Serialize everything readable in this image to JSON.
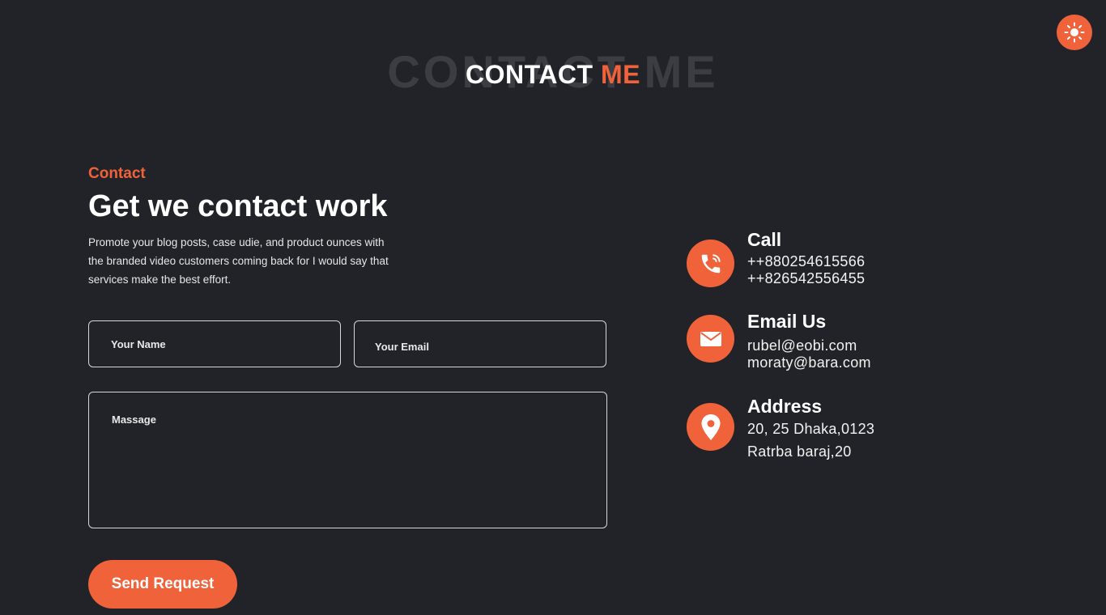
{
  "theme_toggle": {
    "icon": "sun-icon"
  },
  "section_title": {
    "outline_text_main": "CONTACT",
    "outline_text_accent": "ME",
    "main_text": "CONTACT",
    "accent_text": "ME"
  },
  "contact": {
    "eyebrow": "Contact",
    "headline": "Get we contact work",
    "intro_lines": [
      "Promote your blog posts, case udie, and product ounces with",
      "the branded video customers coming back for I would say that",
      "services make the best effort."
    ]
  },
  "form": {
    "name_placeholder": "Your Name",
    "email_placeholder": "Your Email",
    "message_placeholder": "Massage",
    "submit_label": "Send Request"
  },
  "info": {
    "call": {
      "icon": "phone-icon",
      "title": "Call",
      "lines": [
        "++880254615566",
        "++826542556455"
      ]
    },
    "email": {
      "icon": "mail-icon",
      "title": "Email Us",
      "lines": [
        "rubel@eobi.com",
        "moraty@bara.com"
      ]
    },
    "address": {
      "icon": "map-pin-icon",
      "title": "Address",
      "lines": [
        "20, 25 Dhaka,0123",
        "Ratrba baraj,20"
      ]
    }
  },
  "colors": {
    "background": "#212328",
    "accent": "#f0633a",
    "text": "#ffffff"
  }
}
